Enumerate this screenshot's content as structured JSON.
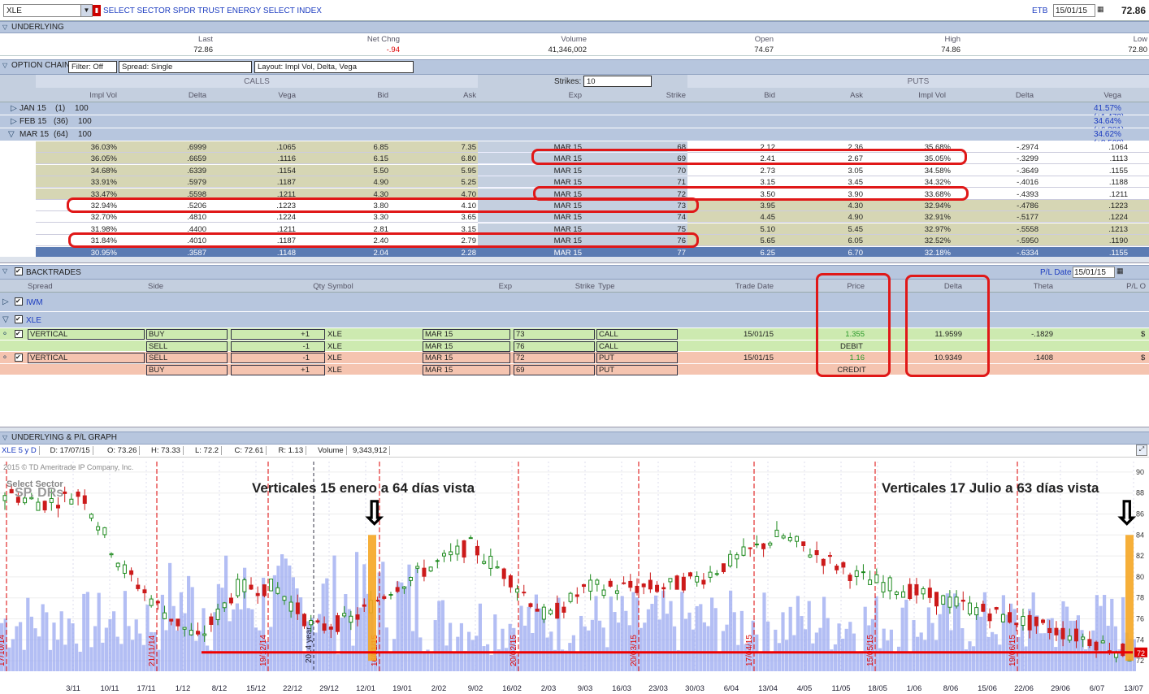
{
  "topbar": {
    "symbol": "XLE",
    "description": "SELECT SECTOR SPDR TRUST ENERGY SELECT INDEX",
    "exchange": "ETB",
    "date": "15/01/15",
    "price": "72.86"
  },
  "underlying": {
    "title": "UNDERLYING",
    "headers": [
      "Last",
      "Net Chng",
      "Volume",
      "Open",
      "High",
      "Low"
    ],
    "values": [
      "72.86",
      "-.94",
      "41,346,002",
      "74.67",
      "74.86",
      "72.80"
    ]
  },
  "option_chain": {
    "title": "OPTION CHAIN",
    "filter": "Filter: Off",
    "spread": "Spread: Single",
    "layout": "Layout: Impl Vol, Delta, Vega",
    "calls_label": "CALLS",
    "puts_label": "PUTS",
    "strikes_label": "Strikes:",
    "strikes_value": "10",
    "call_headers": [
      "Impl Vol",
      "Delta",
      "Vega",
      "Bid",
      "Ask"
    ],
    "mid_headers": [
      "Exp",
      "Strike"
    ],
    "put_headers": [
      "Bid",
      "Ask",
      "Impl Vol",
      "Delta",
      "Vega"
    ],
    "expiries": [
      {
        "name": "JAN 15",
        "count": "(1)",
        "mult": "100",
        "iv": "41.57% (±1.472)"
      },
      {
        "name": "FEB 15",
        "count": "(36)",
        "mult": "100",
        "iv": "34.64% (±6.381)"
      },
      {
        "name": "MAR 15",
        "count": "(64)",
        "mult": "100",
        "iv": "34.62% (±8.508)"
      }
    ],
    "rows": [
      [
        "36.03%",
        ".6999",
        ".1065",
        "6.85",
        "7.35",
        "MAR 15",
        "68",
        "2.12",
        "2.36",
        "35.68%",
        "-.2974",
        ".1064"
      ],
      [
        "36.05%",
        ".6659",
        ".1116",
        "6.15",
        "6.80",
        "MAR 15",
        "69",
        "2.41",
        "2.67",
        "35.05%",
        "-.3299",
        ".1113"
      ],
      [
        "34.68%",
        ".6339",
        ".1154",
        "5.50",
        "5.95",
        "MAR 15",
        "70",
        "2.73",
        "3.05",
        "34.58%",
        "-.3649",
        ".1155"
      ],
      [
        "33.91%",
        ".5979",
        ".1187",
        "4.90",
        "5.25",
        "MAR 15",
        "71",
        "3.15",
        "3.45",
        "34.32%",
        "-.4016",
        ".1188"
      ],
      [
        "33.47%",
        ".5598",
        ".1211",
        "4.30",
        "4.70",
        "MAR 15",
        "72",
        "3.50",
        "3.90",
        "33.68%",
        "-.4393",
        ".1211"
      ],
      [
        "32.94%",
        ".5206",
        ".1223",
        "3.80",
        "4.10",
        "MAR 15",
        "73",
        "3.95",
        "4.30",
        "32.94%",
        "-.4786",
        ".1223"
      ],
      [
        "32.70%",
        ".4810",
        ".1224",
        "3.30",
        "3.65",
        "MAR 15",
        "74",
        "4.45",
        "4.90",
        "32.91%",
        "-.5177",
        ".1224"
      ],
      [
        "31.98%",
        ".4400",
        ".1211",
        "2.81",
        "3.15",
        "MAR 15",
        "75",
        "5.10",
        "5.45",
        "32.97%",
        "-.5558",
        ".1213"
      ],
      [
        "31.84%",
        ".4010",
        ".1187",
        "2.40",
        "2.79",
        "MAR 15",
        "76",
        "5.65",
        "6.05",
        "32.52%",
        "-.5950",
        ".1190"
      ],
      [
        "30.95%",
        ".3587",
        ".1148",
        "2.04",
        "2.28",
        "MAR 15",
        "77",
        "6.25",
        "6.70",
        "32.18%",
        "-.6334",
        ".1155"
      ]
    ]
  },
  "backtrades": {
    "title": "BACKTRADES",
    "pl_date_label": "P/L Date",
    "pl_date": "15/01/15",
    "headers": [
      "Spread",
      "Side",
      "Qty",
      "Symbol",
      "Exp",
      "Strike",
      "Type",
      "Trade Date",
      "Price",
      "Delta",
      "Theta",
      "P/L O"
    ],
    "groups": [
      {
        "name": "IWM"
      },
      {
        "name": "XLE"
      }
    ],
    "trades": [
      {
        "spread": "VERTICAL",
        "legs": [
          {
            "side": "BUY",
            "qty": "+1",
            "symbol": "XLE",
            "exp": "MAR 15",
            "strike": "73",
            "type": "CALL"
          },
          {
            "side": "SELL",
            "qty": "-1",
            "symbol": "XLE",
            "exp": "MAR 15",
            "strike": "76",
            "type": "CALL"
          }
        ],
        "trade_date": "15/01/15",
        "price": "1.355",
        "price_type": "DEBIT",
        "delta": "11.9599",
        "theta": "-.1829",
        "pl": "$"
      },
      {
        "spread": "VERTICAL",
        "legs": [
          {
            "side": "SELL",
            "qty": "-1",
            "symbol": "XLE",
            "exp": "MAR 15",
            "strike": "72",
            "type": "PUT"
          },
          {
            "side": "BUY",
            "qty": "+1",
            "symbol": "XLE",
            "exp": "MAR 15",
            "strike": "69",
            "type": "PUT"
          }
        ],
        "trade_date": "15/01/15",
        "price": "1.16",
        "price_type": "CREDIT",
        "delta": "10.9349",
        "theta": ".1408",
        "pl": "$"
      }
    ]
  },
  "graph": {
    "title": "UNDERLYING & P/L GRAPH",
    "info": [
      "XLE 5 y D",
      "D: 17/07/15",
      "O: 73.26",
      "H: 73.33",
      "L: 72.2",
      "C: 72.61",
      "R: 1.13",
      "Volume",
      "9,343,912"
    ],
    "copyright": "2015 © TD Ameritrade IP Company, Inc.",
    "watermark1": "Select Sector",
    "watermark2": "SP. DRs",
    "annot_left": "Verticales 15 enero  a 64 días vista",
    "annot_right": "Verticales 17 Julio a 63 días vista",
    "year_label": "2014 year",
    "last_label": "72",
    "x_labels": [
      "3/11",
      "10/11",
      "17/11",
      "1/12",
      "8/12",
      "15/12",
      "22/12",
      "29/12",
      "12/01",
      "19/01",
      "2/02",
      "9/02",
      "16/02",
      "2/03",
      "9/03",
      "16/03",
      "23/03",
      "30/03",
      "6/04",
      "13/04",
      "4/05",
      "11/05",
      "18/05",
      "1/06",
      "8/06",
      "15/06",
      "22/06",
      "29/06",
      "6/07",
      "13/07"
    ],
    "expiry_labels": [
      "17/10/14",
      "21/11/14",
      "19/12/14",
      "16/01/15",
      "20/02/15",
      "20/03/15",
      "17/04/15",
      "15/05/15",
      "19/06/15"
    ],
    "y_labels": [
      "90",
      "88",
      "86",
      "84",
      "82",
      "80",
      "78",
      "76",
      "74",
      "72"
    ]
  },
  "chart_data": {
    "type": "candlestick",
    "x_labels": [
      "3/11",
      "10/11",
      "17/11",
      "1/12",
      "8/12",
      "15/12",
      "22/12",
      "29/12",
      "12/01",
      "19/01",
      "2/02",
      "9/02",
      "16/02",
      "2/03",
      "9/03",
      "16/03",
      "23/03",
      "30/03",
      "6/04",
      "13/04",
      "4/05",
      "11/05",
      "18/05",
      "1/06",
      "8/06",
      "15/06",
      "22/06",
      "29/06",
      "6/07",
      "13/07"
    ],
    "ylim": [
      71,
      91
    ],
    "close_by_label": [
      88,
      87,
      88,
      81,
      77,
      74,
      79,
      79,
      75,
      76,
      79,
      81,
      83,
      80,
      76,
      79,
      79,
      79,
      80,
      82,
      84,
      82,
      80,
      79,
      78,
      77,
      76,
      75,
      74,
      72.6
    ],
    "reference_line": 72.8
  }
}
